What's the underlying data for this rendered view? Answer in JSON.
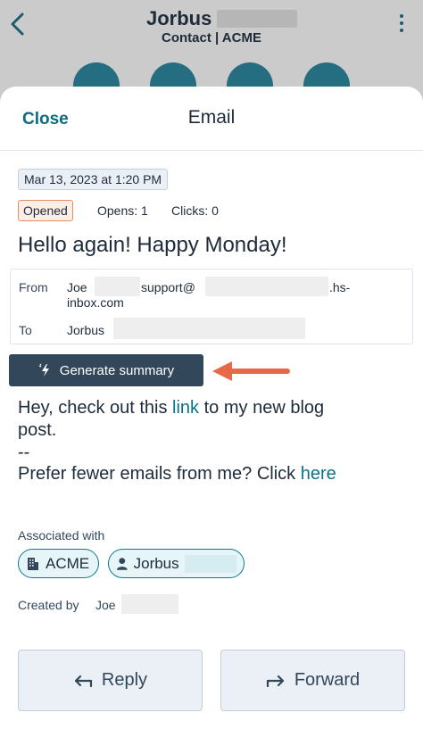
{
  "background": {
    "contact_name": "Jorbus",
    "contact_subtitle": "Contact | ACME"
  },
  "sheet": {
    "close_label": "Close",
    "title": "Email"
  },
  "email": {
    "date": "Mar 13, 2023 at 1:20 PM",
    "status_tag": "Opened",
    "opens": "Opens: 1",
    "clicks": "Clicks: 0",
    "subject": "Hello again! Happy Monday!",
    "from_label": "From",
    "from_name": "Joe",
    "from_support": "support@",
    "from_domain_part1": ".hs-",
    "from_domain_part2": "inbox.com",
    "to_label": "To",
    "to_name": "Jorbus",
    "generate_summary_label": "Generate summary",
    "body": {
      "line1_prefix": "Hey, check out this ",
      "line1_link": "link",
      "line1_suffix": " to my new blog",
      "line2": "post.",
      "signature_separator": "--",
      "line3_prefix": "Prefer fewer emails from me? Click ",
      "line3_link": "here"
    }
  },
  "associations": {
    "label": "Associated with",
    "company_chip": "ACME",
    "contact_chip": "Jorbus"
  },
  "created": {
    "label": "Created by",
    "name": "Joe"
  },
  "actions": {
    "reply_label": "Reply",
    "forward_label": "Forward"
  },
  "colors": {
    "accent": "#0b7285",
    "generate_button": "#33475b",
    "annotation_arrow": "#e8694a",
    "opened_border": "#e58e66"
  }
}
